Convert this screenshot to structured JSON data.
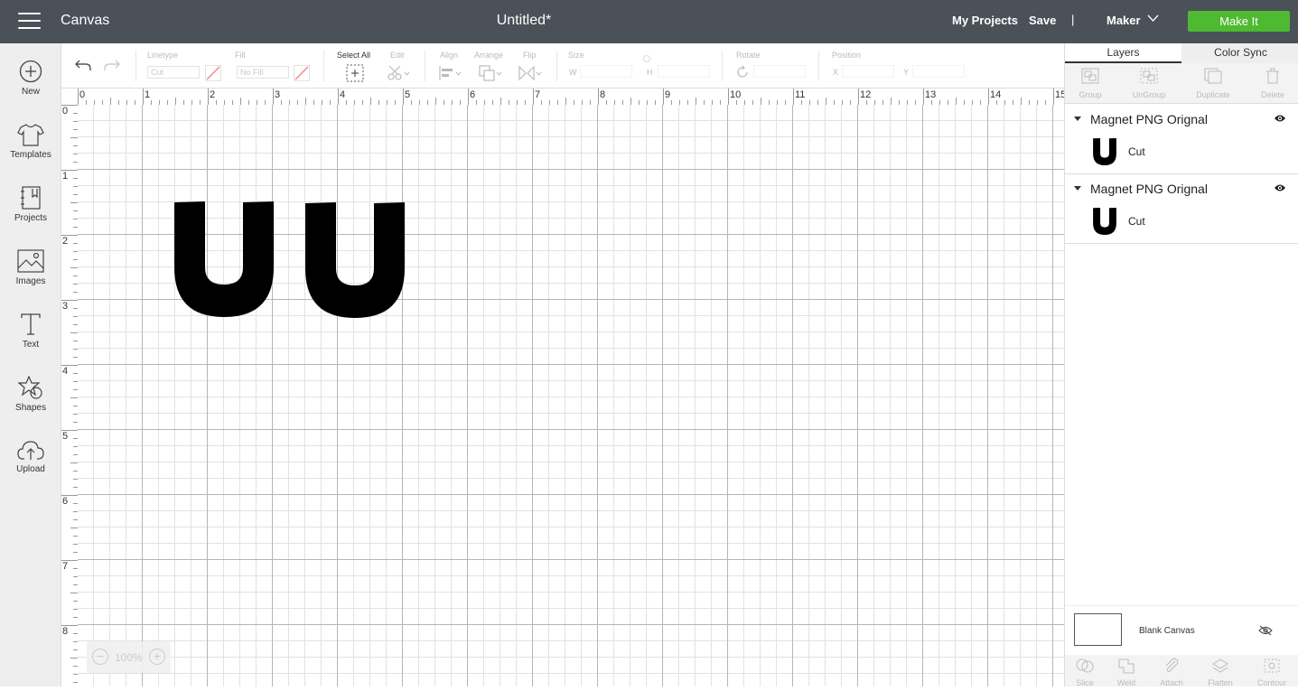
{
  "topbar": {
    "app_title": "Canvas",
    "doc_title": "Untitled*",
    "my_projects": "My Projects",
    "save": "Save",
    "separator": "|",
    "machine": "Maker",
    "make_it": "Make It",
    "make_it_color": "#4dba31"
  },
  "sidebar": {
    "items": [
      {
        "label": "New",
        "icon": "plus-circle-icon"
      },
      {
        "label": "Templates",
        "icon": "shirt-icon"
      },
      {
        "label": "Projects",
        "icon": "notebook-icon"
      },
      {
        "label": "Images",
        "icon": "image-icon"
      },
      {
        "label": "Text",
        "icon": "text-icon"
      },
      {
        "label": "Shapes",
        "icon": "shapes-icon"
      },
      {
        "label": "Upload",
        "icon": "cloud-upload-icon"
      }
    ]
  },
  "toolbar": {
    "linetype_label": "Linetype",
    "linetype_value": "Cut",
    "fill_label": "Fill",
    "fill_value": "No Fill",
    "select_all": "Select All",
    "edit": "Edit",
    "align": "Align",
    "arrange": "Arrange",
    "flip": "Flip",
    "size": "Size",
    "w": "W",
    "h": "H",
    "rotate": "Rotate",
    "position": "Position",
    "x": "X",
    "y": "Y"
  },
  "ruler": {
    "top": [
      "0",
      "1",
      "2",
      "3",
      "4",
      "5",
      "6",
      "7",
      "8",
      "9",
      "10",
      "11",
      "12",
      "13",
      "14",
      "15"
    ],
    "left": [
      "0",
      "1",
      "2",
      "3",
      "4",
      "5",
      "6",
      "7",
      "8"
    ]
  },
  "zoom": {
    "value": "100%",
    "minus": "−",
    "plus": "+"
  },
  "panel": {
    "tabs": [
      "Layers",
      "Color Sync"
    ],
    "tools": [
      "Group",
      "UnGroup",
      "Duplicate",
      "Delete"
    ],
    "layers": [
      {
        "name": "Magnet PNG Orignal",
        "operation": "Cut"
      },
      {
        "name": "Magnet PNG Orignal",
        "operation": "Cut"
      }
    ],
    "blank_canvas": "Blank Canvas",
    "bottom_tools": [
      "Slice",
      "Weld",
      "Attach",
      "Flatten",
      "Contour"
    ]
  }
}
